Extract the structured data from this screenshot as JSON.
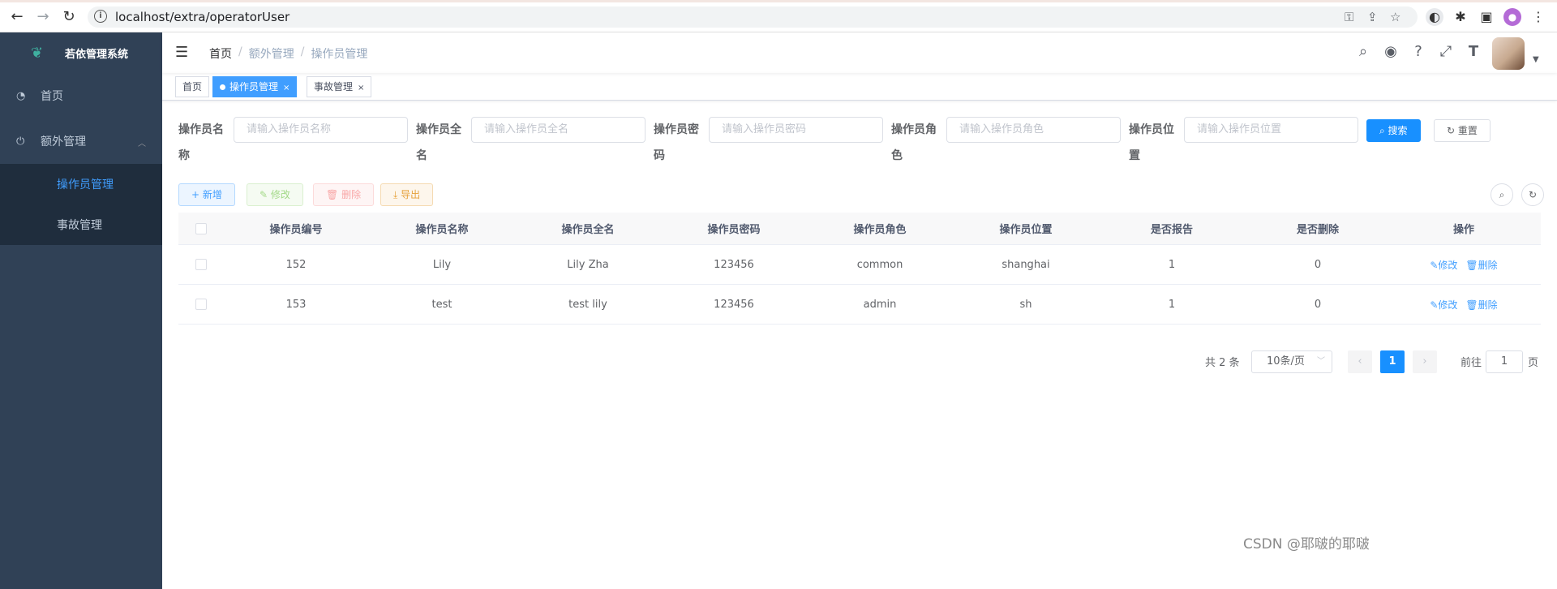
{
  "browser": {
    "url": "localhost/extra/operatorUser",
    "icons": [
      "back-icon",
      "forward-icon",
      "reload-icon",
      "key-icon",
      "share-icon",
      "star-icon",
      "extension-icon",
      "puzzle-icon",
      "sidepanel-icon",
      "profile-icon",
      "menu-icon"
    ]
  },
  "sidebar": {
    "title": "若依管理系统",
    "items": [
      {
        "label": "首页",
        "icon": "dashboard-icon"
      },
      {
        "label": "额外管理",
        "icon": "plug-icon"
      }
    ],
    "sub_items": [
      {
        "label": "操作员管理",
        "active": true
      },
      {
        "label": "事故管理",
        "active": false
      }
    ]
  },
  "navbar": {
    "breadcrumb": [
      "首页",
      "额外管理",
      "操作员管理"
    ],
    "separator": "/"
  },
  "tags": [
    {
      "label": "首页",
      "active": false
    },
    {
      "label": "操作员管理",
      "active": true
    },
    {
      "label": "事故管理",
      "active": false
    }
  ],
  "search": {
    "fields": [
      {
        "label": "操作员名称",
        "placeholder": "请输入操作员名称"
      },
      {
        "label": "操作员全名",
        "placeholder": "请输入操作员全名"
      },
      {
        "label": "操作员密码",
        "placeholder": "请输入操作员密码"
      },
      {
        "label": "操作员角色",
        "placeholder": "请输入操作员角色"
      },
      {
        "label": "操作员位置",
        "placeholder": "请输入操作员位置"
      }
    ],
    "search_label": "搜索",
    "reset_label": "重置"
  },
  "toolbar": {
    "add": "新增",
    "edit": "修改",
    "delete": "删除",
    "export": "导出"
  },
  "table": {
    "columns": [
      "操作员编号",
      "操作员名称",
      "操作员全名",
      "操作员密码",
      "操作员角色",
      "操作员位置",
      "是否报告",
      "是否删除",
      "操作"
    ],
    "rows": [
      [
        "152",
        "Lily",
        "Lily Zha",
        "123456",
        "common",
        "shanghai",
        "1",
        "0"
      ],
      [
        "153",
        "test",
        "test lily",
        "123456",
        "admin",
        "sh",
        "1",
        "0"
      ]
    ],
    "op_edit": "修改",
    "op_delete": "删除"
  },
  "pagination": {
    "total": "共 2 条",
    "page_size": "10条/页",
    "current": "1",
    "goto_label": "前往",
    "goto_value": "1",
    "page_unit": "页"
  },
  "watermark": "CSDN @耶啵的耶啵",
  "colors": {
    "sidebar_bg": "#304156",
    "primary": "#1890ff",
    "tag_active": "#409eff"
  }
}
